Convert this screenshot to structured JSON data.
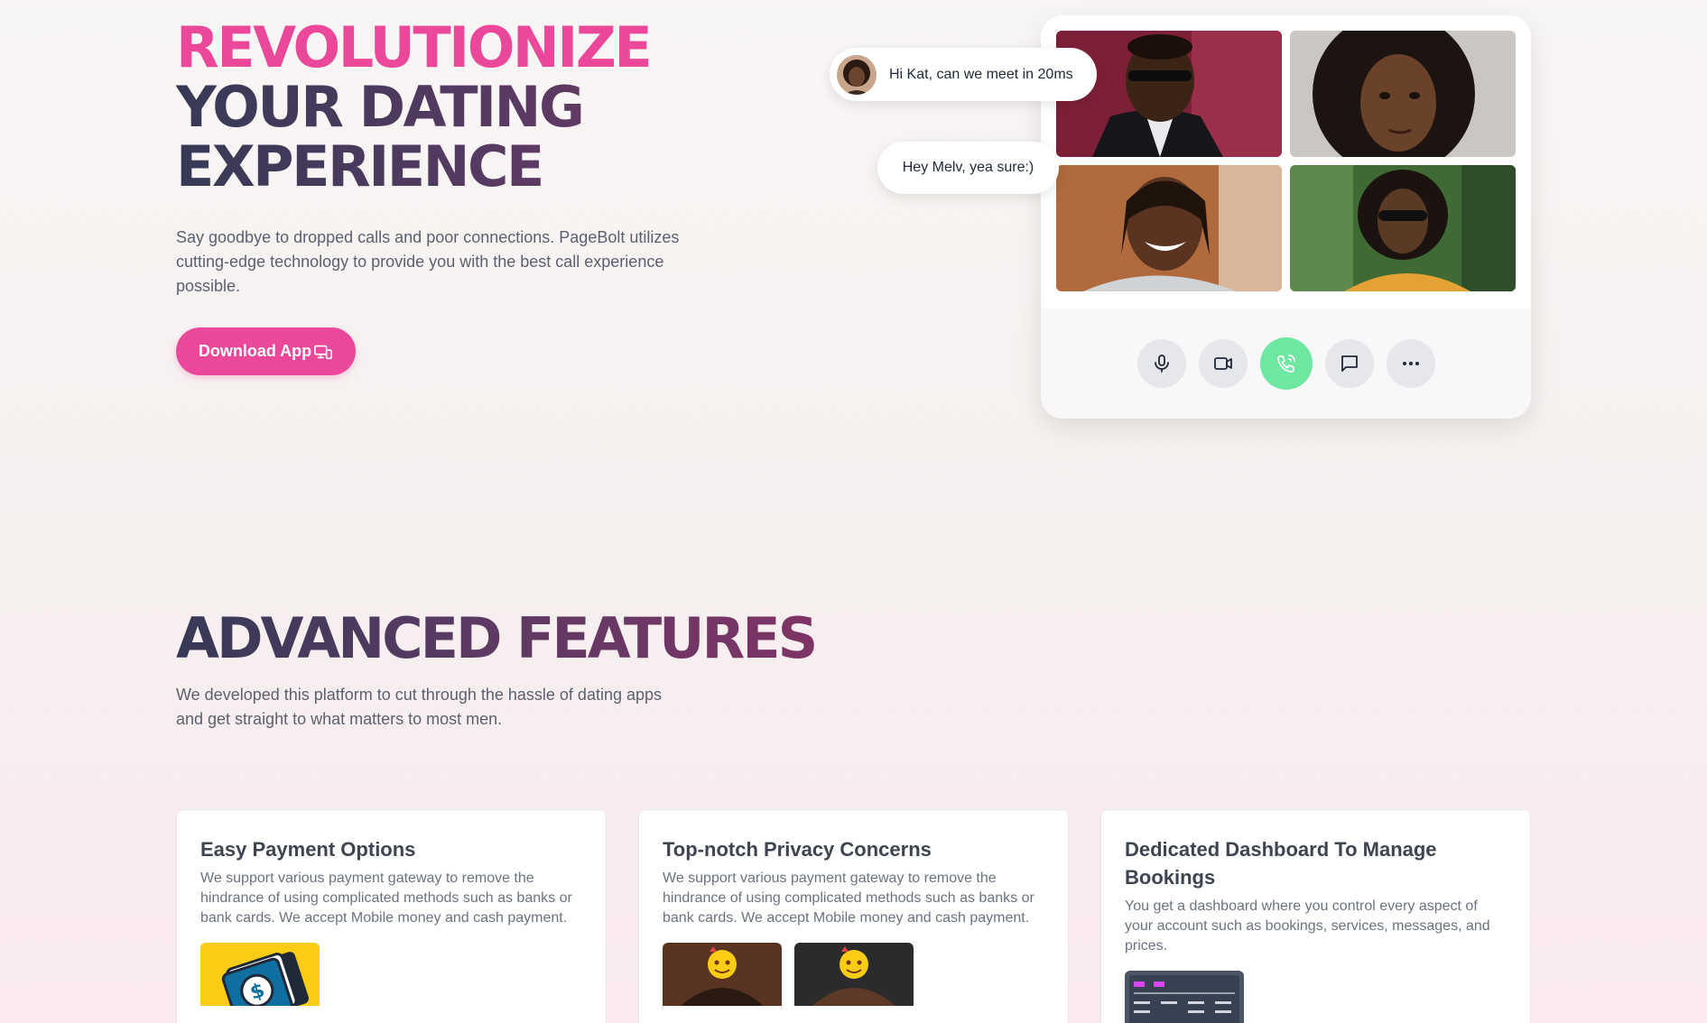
{
  "hero": {
    "title_line1": "REVOLUTIONIZE",
    "title_line2": "YOUR DATING",
    "title_line3": "EXPERIENCE",
    "description": "Say goodbye to dropped calls and poor connections. PageBolt utilizes cutting-edge technology to provide you with the best call experience possible.",
    "cta_label": "Download App",
    "cta_icon": "devices-icon"
  },
  "chat": {
    "message_1": "Hi Kat, can we meet in 20ms",
    "message_2": "Hey Melv, yea sure:)"
  },
  "call_controls": [
    {
      "name": "microphone-icon"
    },
    {
      "name": "video-camera-icon"
    },
    {
      "name": "phone-call-icon"
    },
    {
      "name": "chat-bubble-icon"
    },
    {
      "name": "more-options-icon"
    }
  ],
  "features": {
    "title": "ADVANCED FEATURES",
    "description": "We developed this platform to cut through the hassle of dating apps and get straight to what matters to most men.",
    "cards": [
      {
        "title": "Easy Payment Options",
        "text": "We support various payment gateway to remove the hindrance of using complicated methods such as banks or bank cards. We accept Mobile money and cash payment."
      },
      {
        "title": "Top-notch Privacy Concerns",
        "text": "We support various payment gateway to remove the hindrance of using complicated methods such as banks or bank cards. We accept Mobile money and cash payment."
      },
      {
        "title": "Dedicated Dashboard To Manage Bookings",
        "text": "You get a dashboard where you control every aspect of your account such as bookings, services, messages, and prices."
      }
    ]
  },
  "colors": {
    "accent_pink": "#ec4899",
    "heading_dark": "#363a56",
    "call_green": "#6ee7a1"
  }
}
